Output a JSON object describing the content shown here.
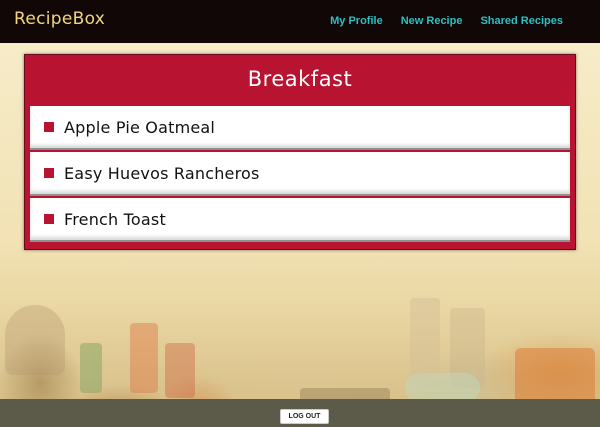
{
  "app": {
    "brand": "RecipeBox"
  },
  "nav": {
    "my_profile": "My Profile",
    "new_recipe": "New Recipe",
    "shared_recipes": "Shared Recipes"
  },
  "category": {
    "title": "Breakfast",
    "recipes": [
      {
        "name": "Apple Pie Oatmeal"
      },
      {
        "name": "Easy Huevos Rancheros"
      },
      {
        "name": "French Toast"
      }
    ]
  },
  "footer": {
    "logout_label": "LOG OUT"
  },
  "colors": {
    "navbar_bg": "#120707",
    "brand": "#f2d77a",
    "nav_link": "#2cbfc4",
    "card_accent": "#b81432",
    "footer_bg": "#5c5a48"
  }
}
